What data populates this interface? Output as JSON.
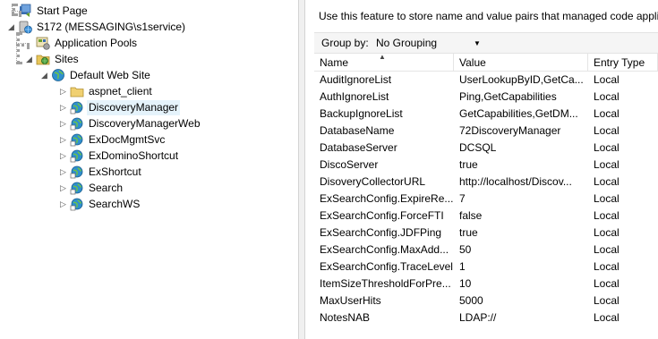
{
  "tree": {
    "nodes": [
      {
        "label": "Start Page",
        "icon": "start-page-icon",
        "indent": 0,
        "expander": ""
      },
      {
        "label": "S172 (MESSAGING\\s1service)",
        "icon": "server-icon",
        "indent": 0,
        "expander": "◢"
      },
      {
        "label": "Application Pools",
        "icon": "app-pools-icon",
        "indent": 1,
        "expander": ""
      },
      {
        "label": "Sites",
        "icon": "sites-folder-icon",
        "indent": 1,
        "expander": "◢"
      },
      {
        "label": "Default Web Site",
        "icon": "globe-icon",
        "indent": 2,
        "expander": "◢"
      },
      {
        "label": "aspnet_client",
        "icon": "folder-icon",
        "indent": 3,
        "expander": "▷"
      },
      {
        "label": "DiscoveryManager",
        "icon": "web-app-icon",
        "indent": 3,
        "expander": "▷",
        "selected": true
      },
      {
        "label": "DiscoveryManagerWeb",
        "icon": "web-app-icon",
        "indent": 3,
        "expander": "▷"
      },
      {
        "label": "ExDocMgmtSvc",
        "icon": "web-app-icon",
        "indent": 3,
        "expander": "▷"
      },
      {
        "label": "ExDominoShortcut",
        "icon": "web-app-icon",
        "indent": 3,
        "expander": "▷"
      },
      {
        "label": "ExShortcut",
        "icon": "web-app-icon",
        "indent": 3,
        "expander": "▷"
      },
      {
        "label": "Search",
        "icon": "web-app-icon",
        "indent": 3,
        "expander": "▷"
      },
      {
        "label": "SearchWS",
        "icon": "web-app-icon",
        "indent": 3,
        "expander": "▷"
      }
    ]
  },
  "content": {
    "description": "Use this feature to store name and value pairs that managed code applic",
    "group_by_label": "Group by:",
    "group_by_value": "No Grouping",
    "columns": [
      "Name",
      "Value",
      "Entry Type"
    ],
    "rows": [
      [
        "AuditIgnoreList",
        "UserLookupByID,GetCa...",
        "Local"
      ],
      [
        "AuthIgnoreList",
        "Ping,GetCapabilities",
        "Local"
      ],
      [
        "BackupIgnoreList",
        "GetCapabilities,GetDM...",
        "Local"
      ],
      [
        "DatabaseName",
        "72DiscoveryManager",
        "Local"
      ],
      [
        "DatabaseServer",
        "DCSQL",
        "Local"
      ],
      [
        "DiscoServer",
        "true",
        "Local"
      ],
      [
        "DisoveryCollectorURL",
        "http://localhost/Discov...",
        "Local"
      ],
      [
        "ExSearchConfig.ExpireRe...",
        "7",
        "Local"
      ],
      [
        "ExSearchConfig.ForceFTI",
        "false",
        "Local"
      ],
      [
        "ExSearchConfig.JDFPing",
        "true",
        "Local"
      ],
      [
        "ExSearchConfig.MaxAdd...",
        "50",
        "Local"
      ],
      [
        "ExSearchConfig.TraceLevel",
        "1",
        "Local"
      ],
      [
        "ItemSizeThresholdForPre...",
        "10",
        "Local"
      ],
      [
        "MaxUserHits",
        "5000",
        "Local"
      ],
      [
        "NotesNAB",
        "LDAP://",
        "Local"
      ]
    ]
  },
  "colors": {
    "selected_bg": "#e5f3fb",
    "groupbar_bg": "#f5f5f5",
    "splitter_bg": "#f0f0f0"
  }
}
